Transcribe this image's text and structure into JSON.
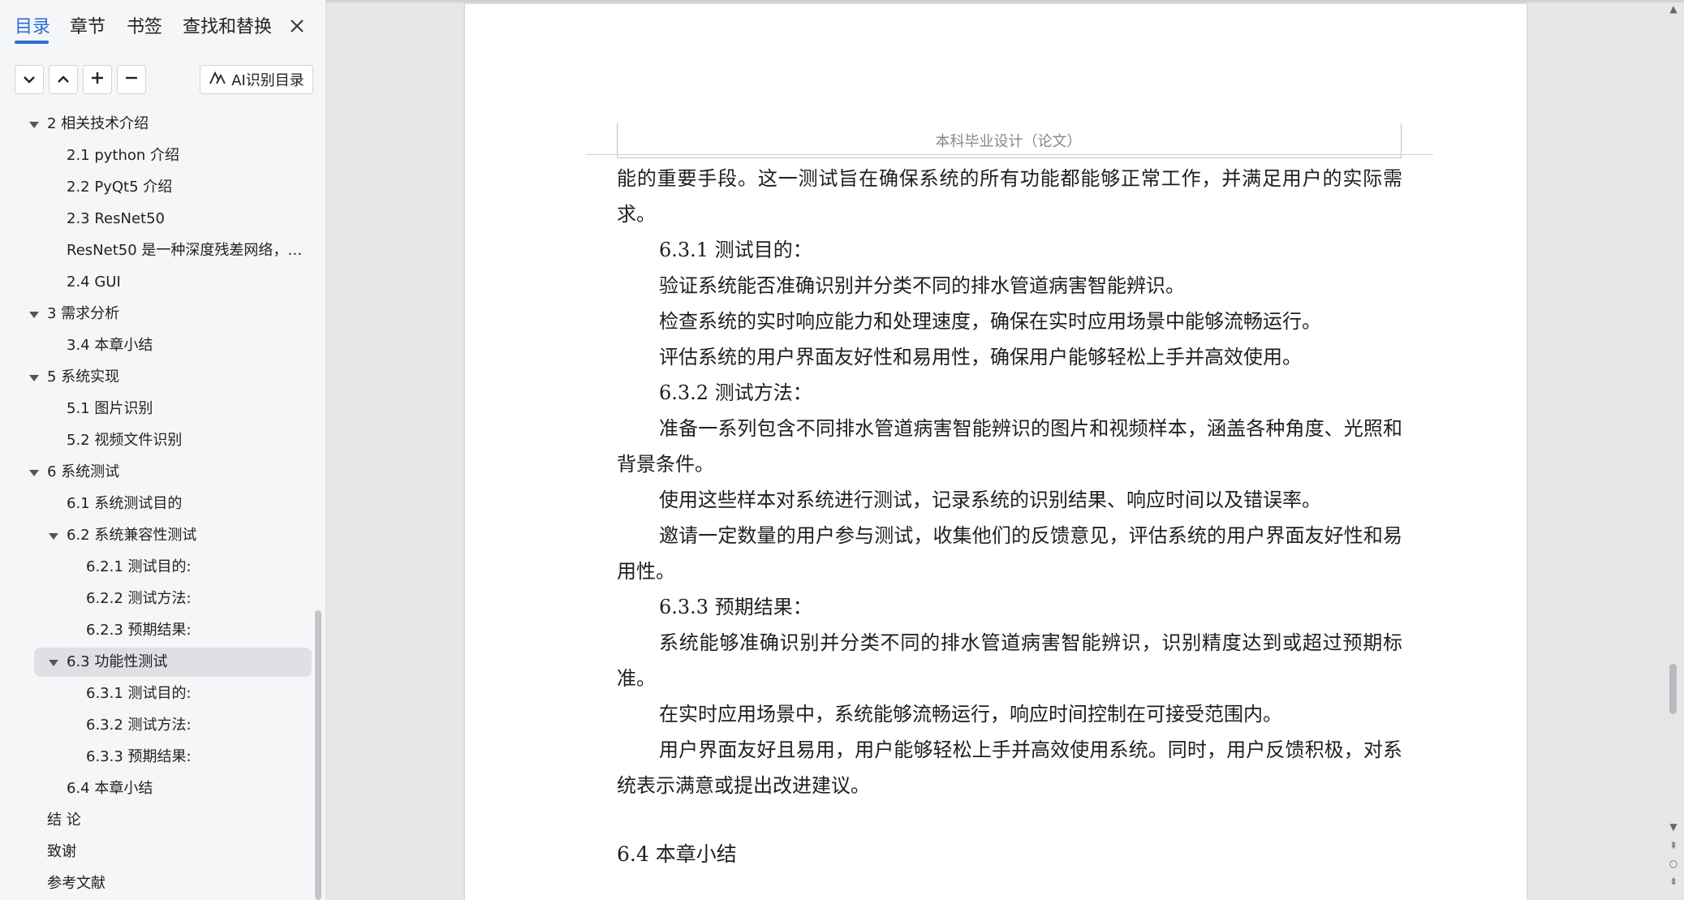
{
  "sidebar": {
    "tabs": [
      "目录",
      "章节",
      "书签",
      "查找和替换"
    ],
    "close_icon": "close-icon",
    "toolbar": {
      "collapse_icon": "chevron-down-icon",
      "expand_icon": "chevron-up-icon",
      "add_icon": "plus-icon",
      "remove_icon": "minus-icon",
      "ai_label": "AI识别目录"
    },
    "toc": [
      {
        "label": "2  相关技术介绍",
        "level": 1,
        "expanded": true
      },
      {
        "label": "2.1 python 介绍",
        "level": 2
      },
      {
        "label": "2.2 PyQt5 介绍",
        "level": 2
      },
      {
        "label": "2.3 ResNet50",
        "level": 2
      },
      {
        "label": "ResNet50 是一种深度残差网络，…",
        "level": 2
      },
      {
        "label": "2.4 GUI",
        "level": 2
      },
      {
        "label": "3  需求分析",
        "level": 1,
        "expanded": true
      },
      {
        "label": "3.4 本章小结",
        "level": 2
      },
      {
        "label": "5 系统实现",
        "level": 1,
        "expanded": true
      },
      {
        "label": "5.1  图片识别",
        "level": 2
      },
      {
        "label": "5.2  视频文件识别",
        "level": 2
      },
      {
        "label": "6  系统测试",
        "level": 1,
        "expanded": true
      },
      {
        "label": "6.1  系统测试目的",
        "level": 2
      },
      {
        "label": "6.2  系统兼容性测试",
        "level": 2,
        "expanded": true
      },
      {
        "label": "6.2.1 测试目的:",
        "level": 3
      },
      {
        "label": "6.2.2 测试方法:",
        "level": 3
      },
      {
        "label": "6.2.3 预期结果:",
        "level": 3
      },
      {
        "label": "6.3  功能性测试",
        "level": 2,
        "expanded": true,
        "selected": true
      },
      {
        "label": "6.3.1 测试目的:",
        "level": 3
      },
      {
        "label": "6.3.2 测试方法:",
        "level": 3
      },
      {
        "label": "6.3.3 预期结果:",
        "level": 3
      },
      {
        "label": "6.4  本章小结",
        "level": 2
      },
      {
        "label": "结    论",
        "level": 1
      },
      {
        "label": "致谢",
        "level": 1
      },
      {
        "label": "参考文献",
        "level": 1
      }
    ]
  },
  "document": {
    "header": "本科毕业设计（论文）",
    "paragraphs": [
      {
        "text": "能的重要手段。这一测试旨在确保系统的所有功能都能够正常工作，并满足用户的实际需求。",
        "indent": false
      },
      {
        "text": "6.3.1 测试目的：",
        "indent": true
      },
      {
        "text": "验证系统能否准确识别并分类不同的排水管道病害智能辨识。",
        "indent": true
      },
      {
        "text": "检查系统的实时响应能力和处理速度，确保在实时应用场景中能够流畅运行。",
        "indent": true
      },
      {
        "text": "评估系统的用户界面友好性和易用性，确保用户能够轻松上手并高效使用。",
        "indent": true
      },
      {
        "text": "6.3.2 测试方法：",
        "indent": true
      },
      {
        "text": "准备一系列包含不同排水管道病害智能辨识的图片和视频样本，涵盖各种角度、光照和背景条件。",
        "indent": true
      },
      {
        "text": "使用这些样本对系统进行测试，记录系统的识别结果、响应时间以及错误率。",
        "indent": true
      },
      {
        "text": "邀请一定数量的用户参与测试，收集他们的反馈意见，评估系统的用户界面友好性和易用性。",
        "indent": true
      },
      {
        "text": "6.3.3 预期结果：",
        "indent": true
      },
      {
        "text": "系统能够准确识别并分类不同的排水管道病害智能辨识，识别精度达到或超过预期标准。",
        "indent": true
      },
      {
        "text": "在实时应用场景中，系统能够流畅运行，响应时间控制在可接受范围内。",
        "indent": true
      },
      {
        "text": "用户界面友好且易用，用户能够轻松上手并高效使用系统。同时，用户反馈积极，对系统表示满意或提出改进建议。",
        "indent": true
      }
    ],
    "section_title": "6.4  本章小结"
  }
}
